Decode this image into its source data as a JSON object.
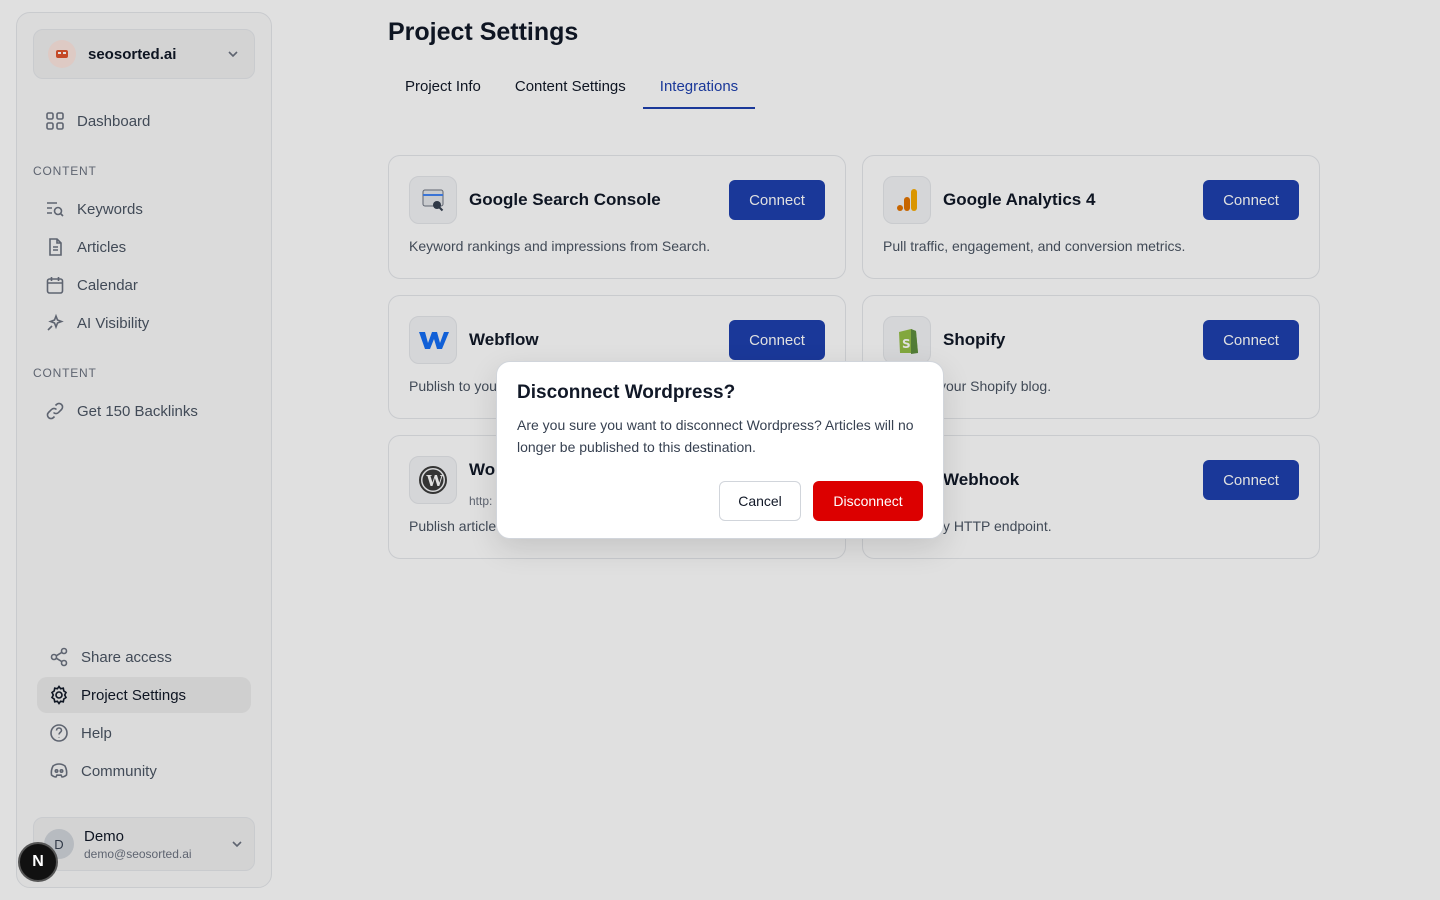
{
  "sidebar": {
    "project_name": "seosorted.ai",
    "nav": {
      "dashboard": "Dashboard",
      "section_content_1": "CONTENT",
      "keywords": "Keywords",
      "articles": "Articles",
      "calendar": "Calendar",
      "ai_visibility": "AI Visibility",
      "section_content_2": "CONTENT",
      "backlinks": "Get 150 Backlinks"
    },
    "bottom": {
      "share_access": "Share access",
      "project_settings": "Project Settings",
      "help": "Help",
      "community": "Community"
    },
    "user": {
      "initial": "D",
      "name": "Demo",
      "email": "demo@seosorted.ai"
    },
    "badge": "N"
  },
  "page": {
    "title": "Project Settings",
    "tabs": [
      "Project Info",
      "Content Settings",
      "Integrations"
    ],
    "active_tab": "Integrations"
  },
  "integrations": [
    {
      "name": "Google Search Console",
      "description": "Keyword rankings and impressions from Search.",
      "button": "Connect"
    },
    {
      "name": "Google Analytics 4",
      "description": "Pull traffic, engagement, and conversion metrics.",
      "button": "Connect"
    },
    {
      "name": "Webflow",
      "description": "Publish to you",
      "button": "Connect"
    },
    {
      "name": "Shopify",
      "description": "rticles to your Shopify blog.",
      "button": "Connect"
    },
    {
      "name": "Wo",
      "url": "http:",
      "description": "Publish article",
      "button": ""
    },
    {
      "name": "Webhook",
      "description": "cles to any HTTP endpoint.",
      "button": "Connect"
    }
  ],
  "modal": {
    "title": "Disconnect Wordpress?",
    "text": "Are you sure you want to disconnect Wordpress? Articles will no longer be published to this destination.",
    "cancel": "Cancel",
    "confirm": "Disconnect"
  },
  "colors": {
    "primary": "#1e40af",
    "danger": "#dc0000"
  }
}
